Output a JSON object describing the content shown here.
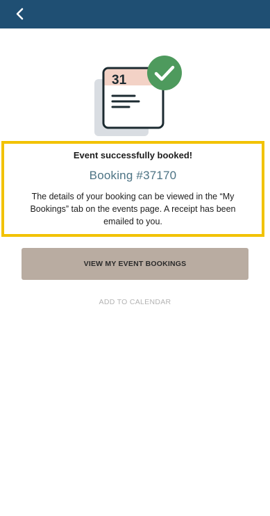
{
  "header": {
    "background_color": "#1f4f73",
    "back_icon": "chevron-left-icon"
  },
  "illustration": {
    "calendar_day": "31",
    "icon": "calendar-icon",
    "badge_icon": "checkmark-icon",
    "badge_color": "#4e9a5d",
    "calendar_header_color": "#f3d2c6",
    "shadow_color": "#d9dde2"
  },
  "confirmation": {
    "title": "Event successfully booked!",
    "booking_number": "Booking #37170",
    "details": "The details of your booking can be viewed in the “My Bookings” tab on the events page. A receipt has been emailed to you.",
    "highlight_color": "#f2c200",
    "booking_number_color": "#4c7384"
  },
  "actions": {
    "view_bookings_label": "VIEW MY EVENT BOOKINGS",
    "add_to_calendar_label": "ADD TO CALENDAR",
    "primary_button_color": "#b9aca1"
  }
}
